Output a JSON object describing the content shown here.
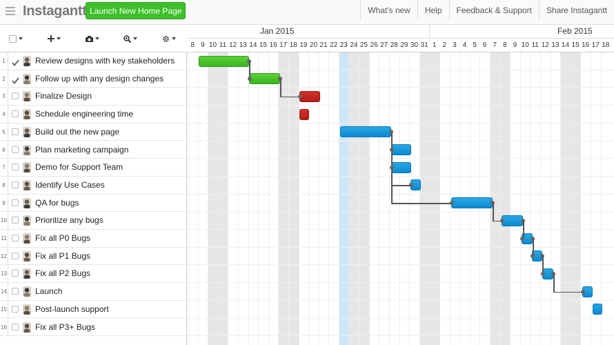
{
  "app": {
    "logo": "Instagantt",
    "project": "Launch New Home Page",
    "nav": [
      "What's new",
      "Help",
      "Feedback & Support",
      "Share Instagantt"
    ]
  },
  "toolbar": {
    "icons": [
      "select-all-icon",
      "plus-icon",
      "camera-icon",
      "zoom-icon",
      "gear-icon"
    ]
  },
  "timeline": {
    "months": [
      "Jan 2015",
      "Feb 2015"
    ],
    "days": [
      "8",
      "9",
      "10",
      "11",
      "12",
      "13",
      "14",
      "15",
      "16",
      "17",
      "18",
      "19",
      "20",
      "21",
      "22",
      "23",
      "24",
      "25",
      "26",
      "27",
      "28",
      "29",
      "30",
      "31",
      "1",
      "2",
      "3",
      "4",
      "5",
      "6",
      "7",
      "8",
      "9",
      "10",
      "11",
      "12",
      "13",
      "14",
      "15",
      "16",
      "17",
      "18"
    ]
  },
  "tasks": [
    {
      "num": "1",
      "name": "Review designs with key stakeholders",
      "done": true
    },
    {
      "num": "2",
      "name": "Follow up with any design changes",
      "done": true
    },
    {
      "num": "3",
      "name": "Finalize Design",
      "done": false
    },
    {
      "num": "4",
      "name": "Schedule engineering time",
      "done": false
    },
    {
      "num": "5",
      "name": "Build out the new page",
      "done": false
    },
    {
      "num": "6",
      "name": "Plan marketing campaign",
      "done": false
    },
    {
      "num": "7",
      "name": "Demo for Support Team",
      "done": false
    },
    {
      "num": "8",
      "name": "Identify Use Cases",
      "done": false
    },
    {
      "num": "9",
      "name": "QA for bugs",
      "done": false
    },
    {
      "num": "10",
      "name": "Prioritize any bugs",
      "done": false
    },
    {
      "num": "11",
      "name": "Fix all P0 Bugs",
      "done": false
    },
    {
      "num": "12",
      "name": "Fix all P1 Bugs",
      "done": false
    },
    {
      "num": "13",
      "name": "Fix all P2 Bugs",
      "done": false
    },
    {
      "num": "14",
      "name": "Launch",
      "done": false
    },
    {
      "num": "15",
      "name": "Post-launch support",
      "done": false
    },
    {
      "num": "16",
      "name": "Fix all P3+ Bugs",
      "done": false
    }
  ],
  "colors": {
    "complete": "#3dbf2a",
    "overdue": "#c42621",
    "scheduled": "#1a9ad9",
    "today": "#cfe6f7",
    "weekend": "#e6e6e6"
  }
}
